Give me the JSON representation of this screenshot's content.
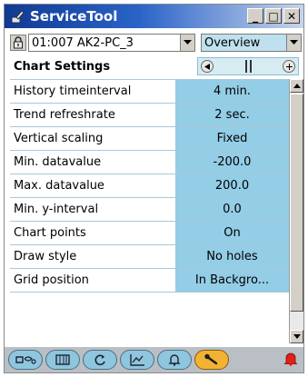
{
  "window": {
    "title": "ServiceTool",
    "minimize_label": "_",
    "maximize_label": "□",
    "close_label": "✕"
  },
  "selector": {
    "device_value": "01:007 AK2-PC_3",
    "view_value": "Overview"
  },
  "section": {
    "title": "Chart Settings"
  },
  "settings": [
    {
      "label": "History timeinterval",
      "value": "4 min."
    },
    {
      "label": "Trend refreshrate",
      "value": "2 sec."
    },
    {
      "label": "Vertical scaling",
      "value": "Fixed"
    },
    {
      "label": "Min. datavalue",
      "value": "-200.0"
    },
    {
      "label": "Max. datavalue",
      "value": "200.0"
    },
    {
      "label": "Min. y-interval",
      "value": "0.0"
    },
    {
      "label": "Chart points",
      "value": "On"
    },
    {
      "label": "Draw style",
      "value": "No holes"
    },
    {
      "label": "Grid position",
      "value": "In Backgro..."
    }
  ],
  "toolbar": {
    "buttons": [
      "connection-icon",
      "controller-icon",
      "refresh-icon",
      "chart-icon",
      "alarm-icon",
      "service-tool-icon"
    ],
    "active_index": 5
  },
  "colors": {
    "value_cell": "#93cde6",
    "accent_active": "#f2b233",
    "alarm": "#e0201b"
  }
}
